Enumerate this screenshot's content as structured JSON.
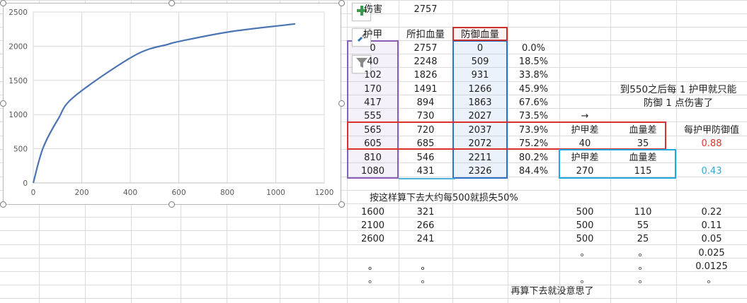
{
  "sheet": {
    "damage_label": "伤害",
    "damage_value": "2757",
    "headers": {
      "armor": "护甲",
      "hp_lost": "所扣血量",
      "hp_blocked": "防御血量"
    },
    "rows": [
      {
        "armor": "0",
        "hp_lost": "2757",
        "hp_blocked": "0",
        "pct": "0.0%"
      },
      {
        "armor": "40",
        "hp_lost": "2248",
        "hp_blocked": "509",
        "pct": "18.5%"
      },
      {
        "armor": "102",
        "hp_lost": "1826",
        "hp_blocked": "931",
        "pct": "33.8%"
      },
      {
        "armor": "170",
        "hp_lost": "1491",
        "hp_blocked": "1266",
        "pct": "45.9%"
      },
      {
        "armor": "417",
        "hp_lost": "894",
        "hp_blocked": "1863",
        "pct": "67.6%"
      },
      {
        "armor": "555",
        "hp_lost": "730",
        "hp_blocked": "2027",
        "pct": "73.5%"
      },
      {
        "armor": "565",
        "hp_lost": "720",
        "hp_blocked": "2037",
        "pct": "73.9%"
      },
      {
        "armor": "605",
        "hp_lost": "685",
        "hp_blocked": "2072",
        "pct": "75.2%"
      },
      {
        "armor": "810",
        "hp_lost": "546",
        "hp_blocked": "2211",
        "pct": "80.2%"
      },
      {
        "armor": "1080",
        "hp_lost": "431",
        "hp_blocked": "2326",
        "pct": "84.4%"
      }
    ],
    "arrow": "→",
    "note_line1": "到550之后每 1 护甲就只能",
    "note_line2": "防御 1 点伤害了",
    "comp1": {
      "h1": "护甲差",
      "h2": "血量差",
      "v1": "40",
      "v2": "35"
    },
    "per_armor_header": "每护甲防御值",
    "per_armor_1": "0.88",
    "comp2": {
      "h1": "护甲差",
      "h2": "血量差",
      "v1": "270",
      "v2": "115"
    },
    "per_armor_2": "0.43",
    "estimate_note": "按这样算下去大约每500就损失50%",
    "projection": [
      {
        "armor": "1600",
        "hp": "321",
        "diff_armor": "500",
        "diff_hp": "110",
        "ratio": "0.22"
      },
      {
        "armor": "2100",
        "hp": "266",
        "diff_armor": "500",
        "diff_hp": "55",
        "ratio": "0.11"
      },
      {
        "armor": "2600",
        "hp": "241",
        "diff_armor": "500",
        "diff_hp": "25",
        "ratio": "0.05"
      },
      {
        "armor": "",
        "hp": "",
        "diff_armor": "。",
        "diff_hp": "。",
        "ratio": "0.025"
      },
      {
        "armor": "。",
        "hp": "。",
        "diff_armor": "",
        "diff_hp": "。",
        "ratio": "0.0125"
      },
      {
        "armor": "。",
        "hp": "。",
        "diff_armor": "。",
        "diff_hp": "。",
        "ratio": "。"
      }
    ],
    "proj_row4_dots": [
      "。",
      "。"
    ],
    "conclusion": "再算下去就没意思了"
  },
  "side_buttons": {
    "add": "chart-elements-icon",
    "style": "chart-styles-icon",
    "filter": "chart-filters-icon"
  },
  "chart_data": {
    "type": "line",
    "x": [
      0,
      40,
      102,
      170,
      417,
      555,
      565,
      605,
      810,
      1080
    ],
    "series": [
      {
        "values": [
          0,
          509,
          931,
          1266,
          1863,
          2027,
          2037,
          2072,
          2211,
          2326
        ]
      }
    ],
    "xlim": [
      0,
      1200
    ],
    "ylim": [
      0,
      2500
    ],
    "xticks": [
      "0",
      "200",
      "400",
      "600",
      "800",
      "1000",
      "1200"
    ],
    "yticks": [
      "0",
      "500",
      "1000",
      "1500",
      "2000",
      "2500"
    ],
    "grid": true,
    "line_color": "#4a74b4"
  }
}
